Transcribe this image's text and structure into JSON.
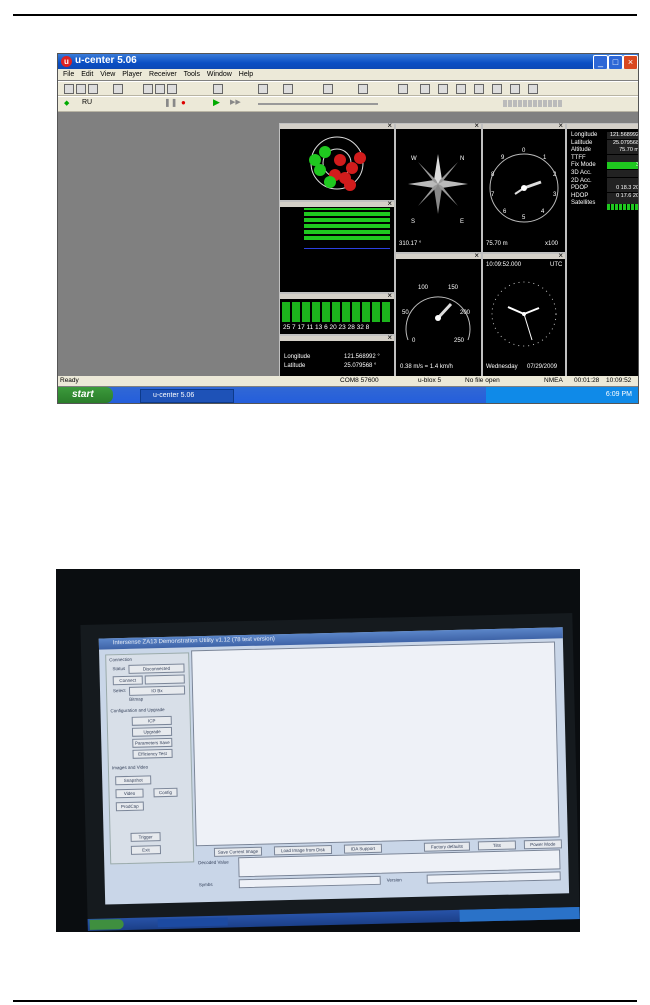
{
  "page": {
    "rule_top": true,
    "rule_bottom": true
  },
  "ucenter": {
    "title": "u-center 5.06",
    "menu": [
      "File",
      "Edit",
      "View",
      "Player",
      "Receiver",
      "Tools",
      "Window",
      "Help"
    ],
    "toolbar_port_label": "RU",
    "sat_signal_bottom": "25 7 17 11 13 6 20 23 28 32 8",
    "compass_heading": "310.17 °",
    "compass_letters": [
      "W",
      "N",
      "S",
      "E"
    ],
    "altimeter_label": "75.70 m",
    "altimeter_scale": "x100",
    "altimeter_numbers": [
      "0",
      "1",
      "2",
      "3",
      "4",
      "5",
      "6",
      "7",
      "8",
      "9"
    ],
    "speed_scale": [
      "50",
      "100",
      "150",
      "200",
      "250",
      "0"
    ],
    "speed_label": "0.38 m/s = 1.4 km/h",
    "clock_time": "10:09:52.000",
    "clock_tz": "UTC",
    "clock_day": "Wednesday",
    "clock_date": "07/29/2009",
    "mini_longitude_label": "Longitude",
    "mini_longitude_value": "121.568992 °",
    "mini_latitude_label": "Latitude",
    "mini_latitude_value": "25.079568 °",
    "info_rows": [
      {
        "label": "Longitude",
        "value": "121.568992"
      },
      {
        "label": "Latitude",
        "value": "25.079568"
      },
      {
        "label": "Altitude",
        "value": "75.70 m"
      },
      {
        "label": "TTFF",
        "value": ""
      },
      {
        "label": "Fix Mode",
        "value": "3"
      },
      {
        "label": "3D Acc.",
        "value": ""
      },
      {
        "label": "2D Acc.",
        "value": ""
      },
      {
        "label": "PDOP",
        "value": "0   18.3  20"
      },
      {
        "label": "HDOP",
        "value": "0   17.6  20"
      },
      {
        "label": "Satellites",
        "value": ""
      }
    ],
    "status": {
      "ready": "Ready",
      "port": "COM8 57600",
      "receiver": "u-blox 5",
      "file": "No file open",
      "protocol": "NMEA",
      "elapsed": "00:01:28",
      "time": "10:09:52"
    },
    "taskbar": {
      "start": "start",
      "task": "u-center 5.06",
      "clock": "6:09 PM"
    },
    "colors": {
      "sat_green": "#1fc81f",
      "sat_red": "#d21c1c",
      "sat_blue": "#2b3fe0"
    }
  },
  "photo": {
    "app_title": "Intersense ZA13 Demonstration Utility v1.12 (78 test version)",
    "section_connection": "Connection",
    "status_label": "Status",
    "status_value": "Disconnected",
    "connect_button": "Connect",
    "port_value": "",
    "select_label": "Select",
    "select_value": "IO Bx",
    "bitmap_label": "Bitmap",
    "section_config": "Configuration and Upgrade",
    "config_buttons": [
      "ICP",
      "Upgrade",
      "Parameters Save",
      "Efficiency Test"
    ],
    "section_images": "Images and Video",
    "snapshot_button": "Snapshot",
    "video_button": "Video",
    "config_button": "Config",
    "prodcap_button": "ProdCap",
    "trigger_button": "Trigger",
    "exit_button": "Exit",
    "bottom_buttons": [
      "Save Current Image",
      "Load Image from Disk",
      "IDA Support",
      "Factory defaults",
      "Tilts",
      "Power Mode"
    ],
    "decoded_label": "Decoded Value",
    "symbol_label": "Symbs",
    "version_label": "Version"
  }
}
